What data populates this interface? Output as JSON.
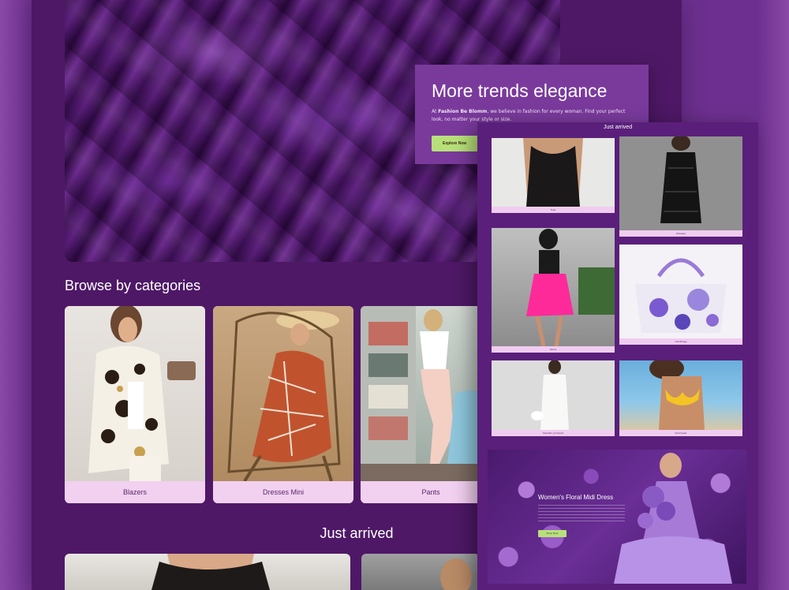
{
  "hero": {
    "alt": "purple silk fabric"
  },
  "browse": {
    "title": "Browse by categories",
    "categories": [
      {
        "label": "Blazers"
      },
      {
        "label": "Dresses Mini"
      },
      {
        "label": "Pants"
      }
    ]
  },
  "just_arrived": {
    "title": "Just arrived"
  },
  "promo": {
    "title": "More trends elegance",
    "text_prefix": "At ",
    "text_brand": "Fashion Be Blomm",
    "text_rest": ", we believe in fashion for every woman. Find your perfect look, no matter your style or size.",
    "button": "Explore Now"
  },
  "panel": {
    "title": "Just arrived",
    "products": [
      {
        "label": "Tops"
      },
      {
        "label": "Dresses"
      },
      {
        "label": "Skirts"
      },
      {
        "label": "Handbags"
      },
      {
        "label": "Sweater Jumpsuit"
      },
      {
        "label": "Swimwear"
      }
    ],
    "banner": {
      "title": "Women's Floral Midi Dress",
      "button": "Shop Now"
    }
  },
  "colors": {
    "page_bg": "#6a2d8c",
    "main_bg": "#4e1866",
    "panel_bg": "#5a1f7a",
    "card_label_bg": "#f2d0f0",
    "accent_button": "#b8e07a"
  }
}
